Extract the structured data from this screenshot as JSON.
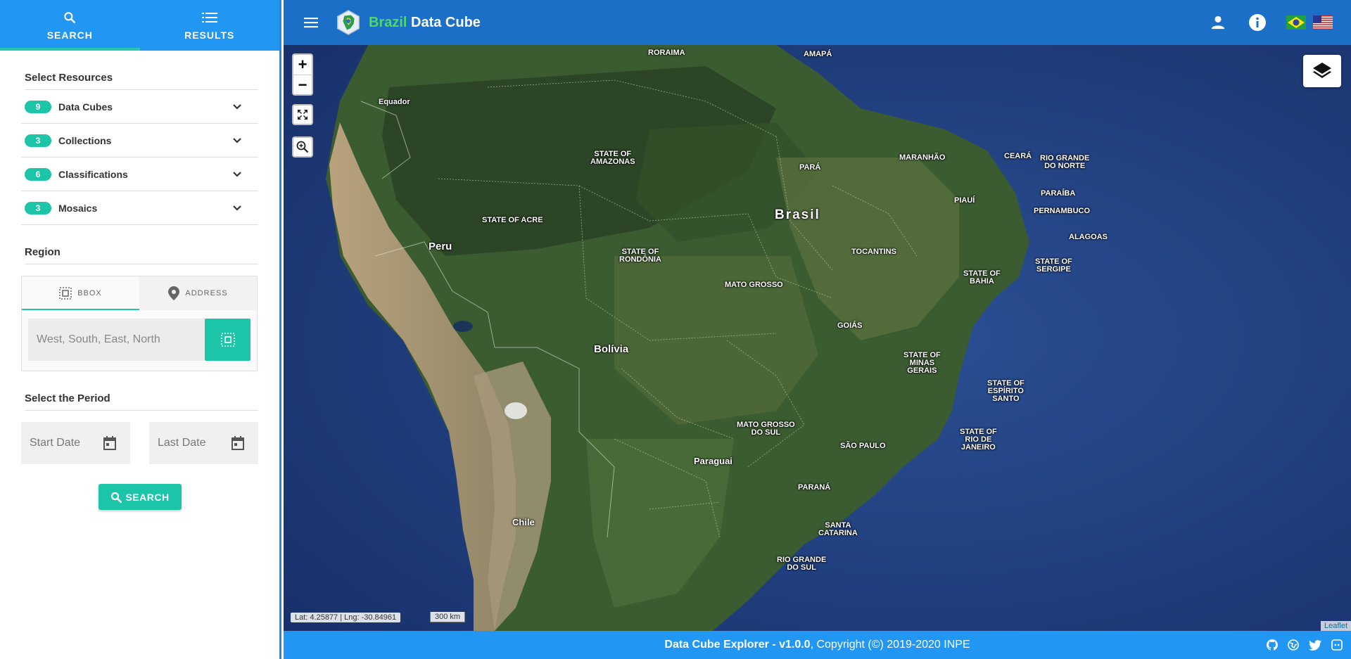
{
  "sidebar": {
    "tabs": [
      {
        "label": "SEARCH",
        "icon": "search-icon"
      },
      {
        "label": "RESULTS",
        "icon": "list-icon"
      }
    ],
    "resources_title": "Select Resources",
    "resources": [
      {
        "count": "9",
        "label": "Data Cubes"
      },
      {
        "count": "3",
        "label": "Collections"
      },
      {
        "count": "6",
        "label": "Classifications"
      },
      {
        "count": "3",
        "label": "Mosaics"
      }
    ],
    "region_title": "Region",
    "region_tabs": [
      {
        "label": "BBOX",
        "icon": "bbox-icon"
      },
      {
        "label": "ADDRESS",
        "icon": "location-pin-icon"
      }
    ],
    "bbox_placeholder": "West, South, East, North",
    "period_title": "Select the Period",
    "start_date": "Start Date",
    "last_date": "Last Date",
    "search_button": "SEARCH"
  },
  "topbar": {
    "brand_accent": "Brazil",
    "brand_rest": " Data Cube"
  },
  "map": {
    "labels": {
      "roraima": "RORAIMA",
      "amapa": "AMAPÁ",
      "equador": "Equador",
      "amazonas": "STATE OF\nAMAZONAS",
      "para": "PARÁ",
      "maranhao": "MARANHÃO",
      "ceara": "CEARÁ",
      "rn": "RIO GRANDE\nDO NORTE",
      "paraiba": "PARAÍBA",
      "piaui": "PIAUÍ",
      "pernambuco": "PERNAMBUCO",
      "alagoas": "ALAGOAS",
      "sergipe": "STATE OF\nSERGIPE",
      "bahia": "STATE OF\nBAHIA",
      "acre": "STATE OF ACRE",
      "rondonia": "STATE OF\nRONDÔNIA",
      "brasil": "Brasil",
      "peru": "Peru",
      "tocantins": "TOCANTINS",
      "mato_grosso": "MATO GROSSO",
      "goias": "GOIÁS",
      "minas": "STATE OF\nMINAS\nGERAIS",
      "bolivia": "Bolívia",
      "espirito": "STATE OF\nESPÍRITO\nSANTO",
      "ms": "MATO GROSSO\nDO SUL",
      "sao_paulo": "SÃO PAULO",
      "rio": "STATE OF\nRIO DE\nJANEIRO",
      "paraguai": "Paraguai",
      "parana": "PARANÁ",
      "chile": "Chile",
      "sc": "SANTA\nCATARINA",
      "rs": "RIO GRANDE\nDO SUL"
    },
    "zoom_in": "+",
    "zoom_out": "−",
    "coords": "Lat: 4.25877 | Lng: -30.84961",
    "scale": "300 km",
    "attribution": "Leaflet"
  },
  "footer": {
    "app_name": "Data Cube Explorer - v1.0.0",
    "copyright": ", Copyright (©) 2019-2020 INPE"
  },
  "colors": {
    "accent": "#1cc4a8",
    "primary": "#2196f3",
    "topbar": "#1c6fc7"
  }
}
